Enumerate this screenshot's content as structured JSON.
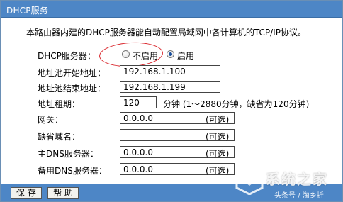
{
  "window": {
    "title": "DHCP服务"
  },
  "intro": "本路由器内建的DHCP服务器能自动配置局域网中各计算机的TCP/IP协议。",
  "dhcp_server": {
    "label": "DHCP服务器：",
    "option_disable": "不启用",
    "option_enable": "启用",
    "selected": "启用"
  },
  "fields": {
    "pool_start": {
      "label": "地址池开始地址：",
      "value": "192.168.1.100"
    },
    "pool_end": {
      "label": "地址池结束地址：",
      "value": "192.168.1.199"
    },
    "lease": {
      "label": "地址租期：",
      "value": "120",
      "unit_note": "分钟  (1～2880分钟，缺省为120分钟)"
    },
    "gateway": {
      "label": "网关：",
      "value": "0.0.0.0",
      "note": "(可选)"
    },
    "domain": {
      "label": "缺省域名：",
      "value": "",
      "note": "(可选)"
    },
    "primary_dns": {
      "label": "主DNS服务器：",
      "value": "0.0.0.0",
      "note": "(可选)"
    },
    "secondary_dns": {
      "label": "备用DNS服务器：",
      "value": "0.0.0.0",
      "note": "(可选)"
    }
  },
  "buttons": {
    "save": "保 存",
    "help": "帮 助"
  },
  "watermark": {
    "text": "系统之家",
    "sub": "头条号 / 淘乡折"
  },
  "colors": {
    "title_bar": "#4d86c6",
    "annotation_ellipse": "#d9262c"
  }
}
